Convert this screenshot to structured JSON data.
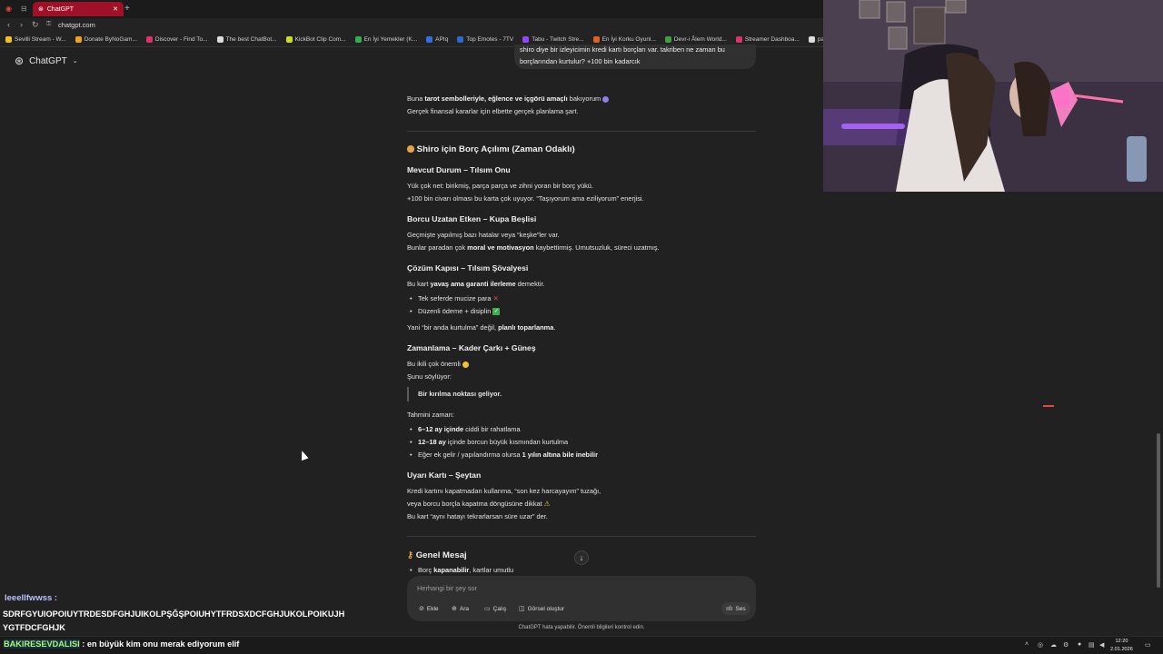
{
  "browser": {
    "tab_title": "ChatGPT",
    "url": "chatgpt.com",
    "bookmarks": [
      {
        "label": "Sevilli Stream - W...",
        "color": "#f0c020"
      },
      {
        "label": "Donate ByNoGam...",
        "color": "#f0a020"
      },
      {
        "label": "Discover - Find To...",
        "color": "#e0316f"
      },
      {
        "label": "The best ChatBot...",
        "color": "#dddddd"
      },
      {
        "label": "KickBot Clip Com...",
        "color": "#c8e020"
      },
      {
        "label": "En İyi Yemekler (K...",
        "color": "#30b050"
      },
      {
        "label": "APIq",
        "color": "#3070e0"
      },
      {
        "label": "Top Emotes - 7TV",
        "color": "#2a6ad0"
      },
      {
        "label": "Tabu - Twitch Stre...",
        "color": "#9146ff"
      },
      {
        "label": "En İyi Korku Oyunl...",
        "color": "#e06020"
      },
      {
        "label": "Devr-i Âlem World...",
        "color": "#40a040"
      },
      {
        "label": "Streamer Dashboa...",
        "color": "#e0316f"
      },
      {
        "label": "parol",
        "color": "#dddddd"
      }
    ]
  },
  "app": {
    "model_label": "ChatGPT",
    "user_message": {
      "line1": "shiro diye bir izleyicimin kredi kartı borçları var. takriben ne zaman bu",
      "line2": "borçlarından kurtulur?    +100 bin kadarcık"
    },
    "intro": {
      "l1_pre": "Buna ",
      "l1_bold": "tarot sembolleriyle, eğlence ve içgörü amaçlı",
      "l1_post": " bakıyorum",
      "l2": "Gerçek finansal kararlar için elbette gerçek planlama şart."
    },
    "title": "Shiro için Borç Açılımı (Zaman Odaklı)",
    "s1": {
      "heading": "Mevcut Durum – Tılsım Onu",
      "l1": "Yük çok net: birikmiş, parça parça ve zihni yoran bir borç yükü.",
      "l2": "+100 bin civarı olması bu karta çok uyuyor. “Taşıyorum ama eziliyorum” enerjisi."
    },
    "s2": {
      "heading": "Borcu Uzatan Etken – Kupa Beşlisi",
      "l1": "Geçmişte yapılmış bazı hatalar veya “keşke”ler var.",
      "l2_pre": "Bunlar paradan çok ",
      "l2_bold": "moral ve motivasyon",
      "l2_post": " kaybettirmiş. Umutsuzluk, süreci uzatmış."
    },
    "s3": {
      "heading": "Çözüm Kapısı – Tılsım Şövalyesi",
      "l1_pre": "Bu kart ",
      "l1_bold": "yavaş ama garanti ilerleme",
      "l1_post": " demektir.",
      "b1": "Tek seferde mucize para",
      "b2": "Düzenli ödeme + disiplin",
      "l2_pre": "Yani “bir anda kurtulma” değil, ",
      "l2_bold": "planlı toparlanma",
      "l2_post": "."
    },
    "s4": {
      "heading": "Zamanlama – Kader Çarkı + Güneş",
      "l1": "Bu ikili çok önemli",
      "l2": "Şunu söylüyor:",
      "quote": "Bir kırılma noktası geliyor.",
      "l3": "Tahmini zaman:",
      "b1_bold": "6–12 ay içinde",
      "b1_post": " ciddi bir rahatlama",
      "b2_bold": "12–18 ay",
      "b2_post": " içinde borcun büyük kısmından kurtulma",
      "b3_pre": "Eğer ek gelir / yapılandırma olursa ",
      "b3_bold": "1 yılın altına bile inebilir"
    },
    "s5": {
      "heading": "Uyarı Kartı – Şeytan",
      "l1": "Kredi kartını kapatmadan kullanma, “son kez harcayayım” tuzağı,",
      "l2": "veya borcu borçla kapatma döngüsüne dikkat",
      "l3": "Bu kart “aynı hatayı tekrarlarsan süre uzar” der."
    },
    "s6": {
      "heading": "Genel Mesaj",
      "b1_pre": "Borç ",
      "b1_bold": "kapanabilir",
      "b1_post": ", kartlar umutlu"
    },
    "composer": {
      "placeholder": "Herhangi bir şey sor",
      "tools": [
        "Ekle",
        "Ara",
        "Çalış",
        "Görsel oluştur"
      ],
      "voice": "Ses"
    },
    "disclaimer": "ChatGPT hata yapabilir. Önemli bilgileri kontrol edin."
  },
  "stream_overlay": {
    "username": "leeellfwwss :",
    "message": "SDRFGYUIOPOIUYTRDESDFGHJUIKOLPŞĞŞPOIUHYTFRDSXDCFGHJUKOLPOIKUJH YGTFDCFGHJK",
    "ticker_user": "BAKIRESEVDALISI",
    "ticker_msg": " : en büyük kim onu merak ediyorum elif"
  },
  "taskbar": {
    "time": "12:20",
    "date": "2.01.2026"
  }
}
